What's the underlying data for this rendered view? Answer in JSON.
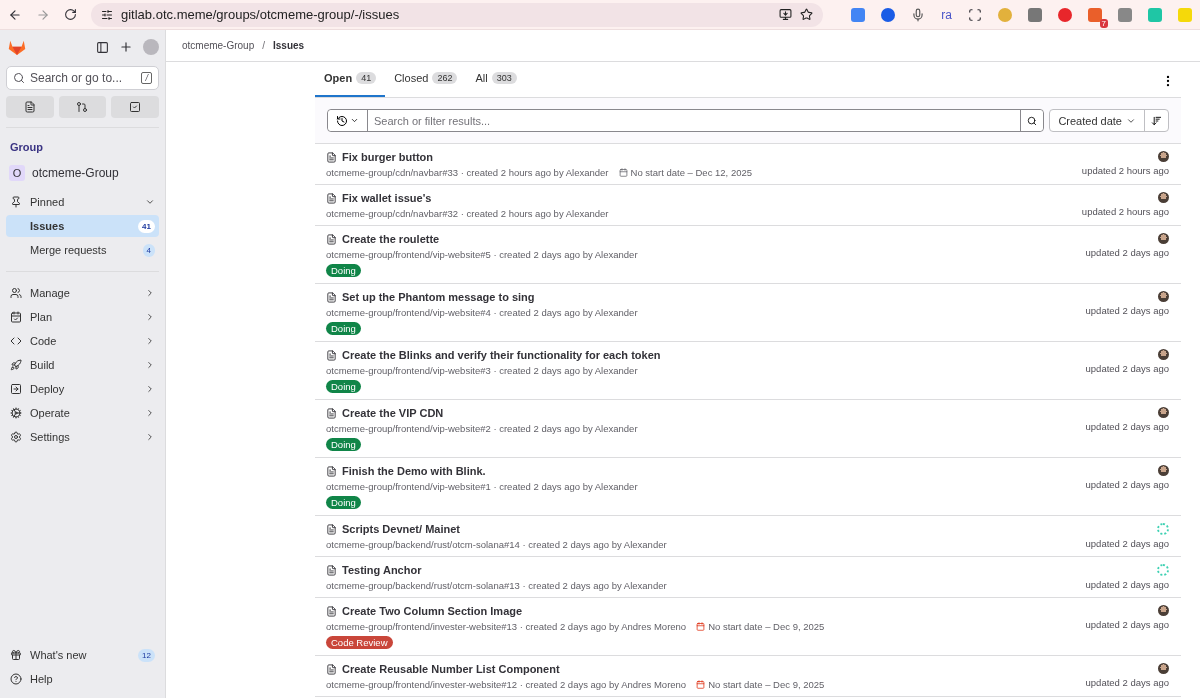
{
  "browser": {
    "url": "gitlab.otc.meme/groups/otcmeme-group/-/issues",
    "extension_text": "ra",
    "extension_badge": "7"
  },
  "sidebar": {
    "search": {
      "placeholder": "Search or go to...",
      "shortcut": "/"
    },
    "context_heading": "Group",
    "group": {
      "initial": "O",
      "name": "otcmeme-Group"
    },
    "pinned": {
      "label": "Pinned",
      "expanded": true,
      "items": [
        {
          "label": "Issues",
          "count": "41",
          "selected": true
        },
        {
          "label": "Merge requests",
          "count": "4",
          "selected": false
        }
      ]
    },
    "nav": [
      {
        "kind": "manage",
        "label": "Manage"
      },
      {
        "kind": "plan",
        "label": "Plan"
      },
      {
        "kind": "code",
        "label": "Code"
      },
      {
        "kind": "build",
        "label": "Build"
      },
      {
        "kind": "deploy",
        "label": "Deploy"
      },
      {
        "kind": "operate",
        "label": "Operate"
      },
      {
        "kind": "settings",
        "label": "Settings"
      }
    ],
    "footer": [
      {
        "kind": "whatsnew",
        "label": "What's new",
        "count": "12"
      },
      {
        "kind": "help",
        "label": "Help"
      }
    ]
  },
  "breadcrumb": [
    "otcmeme-Group",
    "Issues"
  ],
  "breadcrumb_separator": "/",
  "tabs": [
    {
      "label": "Open",
      "count": "41",
      "selected": true
    },
    {
      "label": "Closed",
      "count": "262",
      "selected": false
    },
    {
      "label": "All",
      "count": "303",
      "selected": false
    }
  ],
  "filter": {
    "placeholder": "Search or filter results...",
    "sort": "Created date"
  },
  "issues": [
    {
      "title": "Fix burger button",
      "meta": "otcmeme-group/cdn/navbar#33 · created 2 hours ago by Alexander",
      "due": {
        "text": "No start date – Dec 12, 2025",
        "overdue": false
      },
      "avatar": {
        "kind": "photo"
      },
      "updated": "updated 2 hours ago"
    },
    {
      "title": "Fix wallet issue's",
      "meta": "otcmeme-group/cdn/navbar#32 · created 2 hours ago by Alexander",
      "avatar": {
        "kind": "photo"
      },
      "updated": "updated 2 hours ago"
    },
    {
      "title": "Create the roulette",
      "meta": "otcmeme-group/frontend/vip-website#5 · created 2 days ago by Alexander",
      "label": {
        "text": "Doing",
        "color": "#108548"
      },
      "avatar": {
        "kind": "photo"
      },
      "updated": "updated 2 days ago"
    },
    {
      "title": "Set up the Phantom message to sing",
      "meta": "otcmeme-group/frontend/vip-website#4 · created 2 days ago by Alexander",
      "label": {
        "text": "Doing",
        "color": "#108548"
      },
      "avatar": {
        "kind": "photo"
      },
      "updated": "updated 2 days ago"
    },
    {
      "title": "Create the Blinks and verify their functionality for each token",
      "meta": "otcmeme-group/frontend/vip-website#3 · created 2 days ago by Alexander",
      "label": {
        "text": "Doing",
        "color": "#108548"
      },
      "avatar": {
        "kind": "photo"
      },
      "updated": "updated 2 days ago"
    },
    {
      "title": "Create the VIP CDN",
      "meta": "otcmeme-group/frontend/vip-website#2 · created 2 days ago by Alexander",
      "label": {
        "text": "Doing",
        "color": "#108548"
      },
      "avatar": {
        "kind": "photo"
      },
      "updated": "updated 2 days ago"
    },
    {
      "title": "Finish the Demo with Blink.",
      "meta": "otcmeme-group/frontend/vip-website#1 · created 2 days ago by Alexander",
      "label": {
        "text": "Doing",
        "color": "#108548"
      },
      "avatar": {
        "kind": "photo"
      },
      "updated": "updated 2 days ago"
    },
    {
      "title": "Scripts Devnet/ Mainet",
      "meta": "otcmeme-group/backend/rust/otcm-solana#14 · created 2 days ago by Alexander",
      "avatar": {
        "kind": "pattern"
      },
      "updated": "updated 2 days ago"
    },
    {
      "title": "Testing Anchor",
      "meta": "otcmeme-group/backend/rust/otcm-solana#13 · created 2 days ago by Alexander",
      "avatar": {
        "kind": "pattern"
      },
      "updated": "updated 2 days ago"
    },
    {
      "title": "Create Two Column Section Image",
      "meta": "otcmeme-group/frontend/invester-website#13 · created 2 days ago by Andres Moreno",
      "due": {
        "text": "No start date – Dec 9, 2025",
        "overdue": true
      },
      "label": {
        "text": "Code Review",
        "color": "#c9463a"
      },
      "avatar": {
        "kind": "photo"
      },
      "updated": "updated 2 days ago"
    },
    {
      "title": "Create Reusable Number List Component",
      "meta": "otcmeme-group/frontend/invester-website#12 · created 2 days ago by Andres Moreno",
      "due": {
        "text": "No start date – Dec 9, 2025",
        "overdue": true
      },
      "avatar": {
        "kind": "photo"
      },
      "updated": "updated 2 days ago"
    }
  ]
}
